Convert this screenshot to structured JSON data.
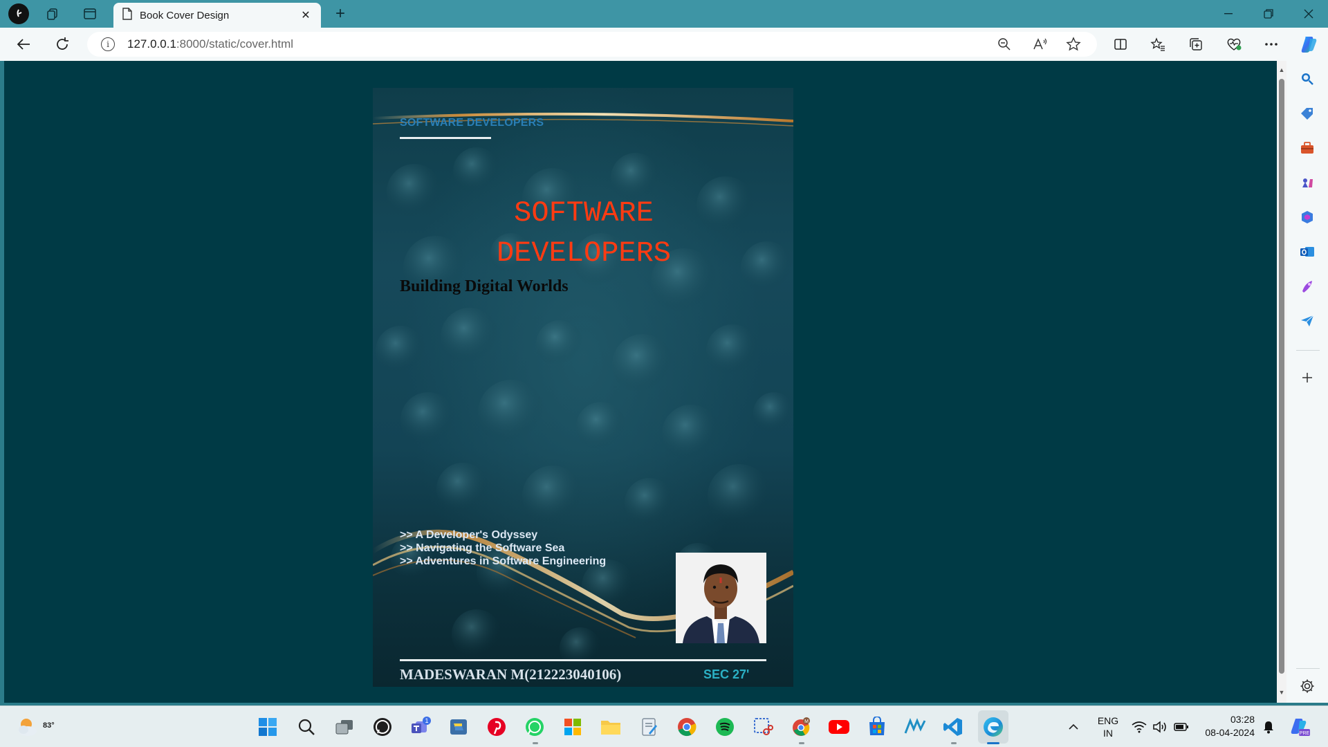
{
  "browser": {
    "tab": {
      "title": "Book Cover Design"
    },
    "url": {
      "host": "127.0.0.1",
      "rest": ":8000/static/cover.html"
    }
  },
  "cover": {
    "top_label": "SOFTWARE DEVELOPERS",
    "title_line1": "SOFTWARE",
    "title_line2": "DEVELOPERS",
    "subtitle": "Building Digital Worlds",
    "bullets": [
      ">> A Developer's Odyssey",
      ">> Navigating the Software Sea",
      ">> Adventures in Software Engineering"
    ],
    "author": "MADESWARAN M(212223040106)",
    "section": "SEC 27'"
  },
  "taskbar": {
    "weather_temp": "83°",
    "teams_badge": "1",
    "gmail_badge": "M",
    "language_line1": "ENG",
    "language_line2": "IN",
    "time": "03:28",
    "date": "08-04-2024",
    "copilot_badge": "PRE"
  },
  "colors": {
    "titlebar": "#3e95a5",
    "page_background": "#003a45",
    "cover_title": "#ff3b12",
    "cover_top_label": "#2a7fb6",
    "section_label": "#2bb0c4"
  }
}
